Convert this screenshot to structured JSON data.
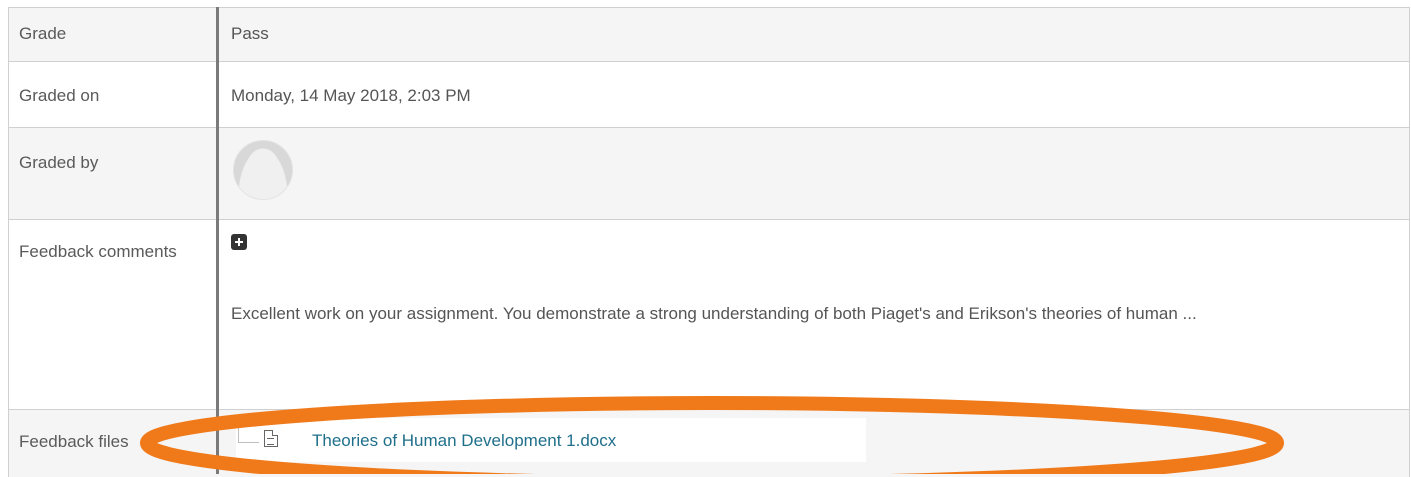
{
  "rows": {
    "grade": {
      "label": "Grade",
      "value": "Pass"
    },
    "graded_on": {
      "label": "Graded on",
      "value": "Monday, 14 May 2018, 2:03 PM"
    },
    "graded_by": {
      "label": "Graded by"
    },
    "feedback_comments": {
      "label": "Feedback comments",
      "value": "Excellent work on your assignment. You demonstrate a strong understanding of both Piaget's and Erikson's theories of human ..."
    },
    "feedback_files": {
      "label": "Feedback files",
      "file_name": "Theories of Human Development 1.docx"
    }
  },
  "icons": {
    "expand": "plus-icon",
    "file": "document-icon",
    "avatar": "user-avatar"
  },
  "colors": {
    "link": "#1f6f8b",
    "highlight": "#f07a1a",
    "row_alt": "#f5f5f5"
  }
}
